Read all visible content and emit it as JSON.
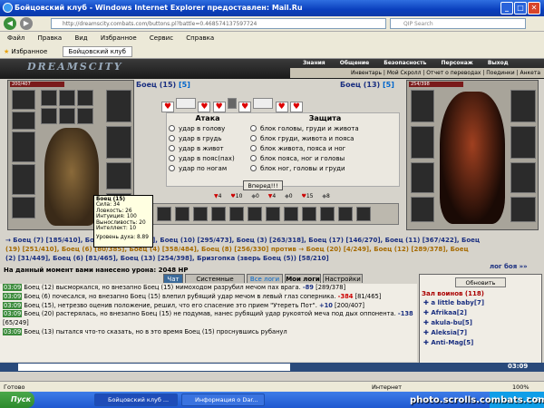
{
  "window": {
    "title": "Бойцовский клуб - Windows Internet Explorer предоставлен: Mail.Ru",
    "min": "_",
    "max": "□",
    "close": "✕"
  },
  "address": {
    "url": "http://dreamscity.combats.com/buttons.pl?battle=0.468574137597724",
    "search_placeholder": "QIP Search"
  },
  "menu": [
    "Файл",
    "Правка",
    "Вид",
    "Избранное",
    "Сервис",
    "Справка"
  ],
  "favorites": {
    "label": "Избранное",
    "tab": "Бойцовский клуб"
  },
  "game": {
    "logo": "DREAMSCITY",
    "top_nav": [
      "Знания",
      "Общение",
      "Безопасность",
      "Персонаж",
      "Выход"
    ],
    "sub_nav": "Инвентарь | Мой Скролл | Отчет о переводах | Поединки | Анкета",
    "left_fighter": {
      "name": "Боец (15)",
      "level_suffix": "[5]",
      "hp": "200/407"
    },
    "right_fighter": {
      "name": "Боец (13)",
      "level_suffix": "[5]",
      "hp": "254/398"
    },
    "attack_header": "Атака",
    "defense_header": "Защита",
    "attack_options": [
      "удар в голову",
      "удар в грудь",
      "удар в живот",
      "удар в пояс(пах)",
      "удар по ногам"
    ],
    "defense_options": [
      "блок головы, груди и живота",
      "блок груди, живота и пояса",
      "блок живота, пояса и ног",
      "блок пояса, ног и головы",
      "блок ног, головы и груди"
    ],
    "forward_button": "Вперед!!!",
    "counters": [
      "4",
      "10",
      "0",
      "4",
      "0",
      "15",
      "8"
    ],
    "tooltip": {
      "title": "Боец (15)",
      "lines": [
        "Сила: 34",
        "Ловкость: 26",
        "Интуиция: 100",
        "Выносливость: 20",
        "Интеллект: 10"
      ],
      "footer": "Уровень духа: 8.89"
    },
    "players_line1": "→ Боец (7) [185/410], Боец (...) [200/407], Боец (10) [295/473], Боец (3) [263/318], Боец (17) [146/270], Боец (11) [367/422], Боец",
    "players_line2": "(19) [251/410], Боец (6) [80/385], Боец (4) [358/484], Боец (8) [256/330] против → Боец (20) [4/249], Боец (12) [289/378], Боец",
    "players_line3": "(2) [31/449], Боец (6) [81/465], Боец (13) [254/398], Бризгопка (зверь Боец (5)) [58/210]",
    "log_link": "лог боя »»",
    "damage_line": "На данный момент вами нанесено урона: 2048 HP",
    "tabs": [
      "Чат",
      "Системные сообщения",
      "Все логи",
      "Мои логи",
      "Настройки"
    ],
    "refresh_button": "Обновить",
    "hall_title": "Зал воинов (118)",
    "roster": [
      "a little baby[7]",
      "Afrikaa[2]",
      "akula-bu[5]",
      "Aleksia[7]",
      "Anti-Mag[5]"
    ],
    "log": [
      {
        "time": "03:09",
        "text": "Боец (12) высморкался, но внезапно Боец (15) мимоходом разрубил мечом пах врага.",
        "dmg": "-89",
        "tail": "[289/378]"
      },
      {
        "time": "03:09",
        "text": "Боец (6) почесался, но внезапно Боец (15) влепил рубящий удар мечом в левый глаз соперника.",
        "dmg": "-384",
        "tail": "[81/465]"
      },
      {
        "time": "03:09",
        "text": "Боец (15), нетрезво оценив положение, решил, что его спасение это прием \"Утереть Пот\".",
        "dmg": "+10",
        "tail": "[200/407]"
      },
      {
        "time": "03:09",
        "text": "Боец (20) растерялась, но внезапно Боец (15) не подумав, нанес рубящий удар рукоятой меча под дых оппонента.",
        "dmg": "-138",
        "tail": "[65/249]"
      },
      {
        "time": "03:09",
        "text": "Боец (13) пытался что-то сказать, но в это время Боец (15) проснувшись рубанул",
        "dmg": "",
        "tail": ""
      }
    ],
    "clock": "03:09"
  },
  "status": {
    "left": "Готово",
    "zone": "Интернет",
    "zoom": "100%"
  },
  "taskbar": {
    "start": "Пуск",
    "tasks": [
      "Бойцовский клуб ...",
      "Информация о Dar..."
    ],
    "time": "3:09"
  },
  "watermark": "photo.scrolls.combats.com",
  "colors": {
    "title_blue": "#0a3fbd",
    "player_blue": "#1a2f80",
    "player_orange": "#a56a00",
    "damage_red": "#c00000"
  }
}
